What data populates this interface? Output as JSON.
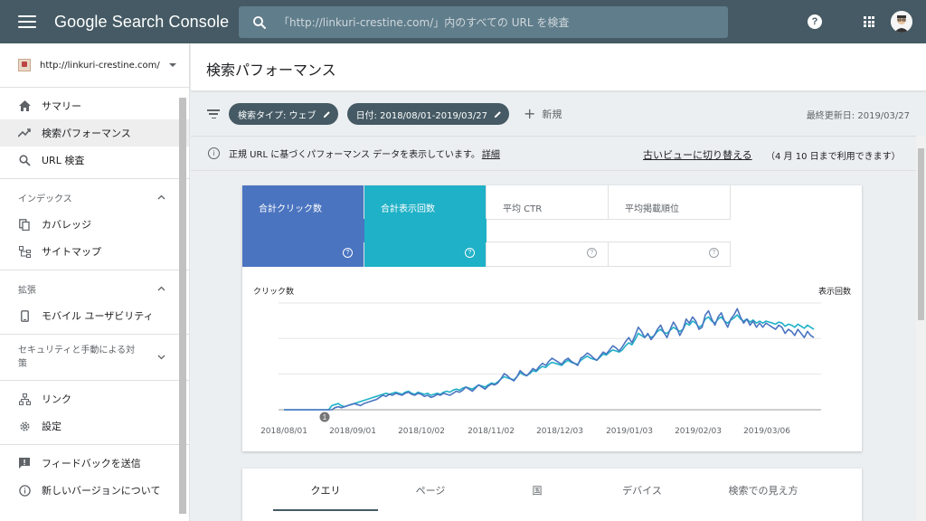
{
  "app": {
    "title": "Google Search Console",
    "search_placeholder": "「http://linkuri-crestine.com/」内のすべての URL を検査"
  },
  "sidebar": {
    "property": "http://linkuri-crestine.com/",
    "items_top": [
      {
        "label": "サマリー",
        "icon": "home-icon"
      },
      {
        "label": "検索パフォーマンス",
        "icon": "trending-icon",
        "active": true
      },
      {
        "label": "URL 検査",
        "icon": "search-icon"
      }
    ],
    "section_index": "インデックス",
    "items_index": [
      {
        "label": "カバレッジ",
        "icon": "copy-icon"
      },
      {
        "label": "サイトマップ",
        "icon": "sitemap-icon"
      }
    ],
    "section_ext": "拡張",
    "items_ext": [
      {
        "label": "モバイル ユーザビリティ",
        "icon": "phone-icon"
      }
    ],
    "section_security": "セキュリティと手動による対策",
    "items_bottom": [
      {
        "label": "リンク",
        "icon": "links-icon"
      },
      {
        "label": "設定",
        "icon": "gear-icon"
      }
    ],
    "items_footer": [
      {
        "label": "フィードバックを送信",
        "icon": "feedback-icon"
      },
      {
        "label": "新しいバージョンについて",
        "icon": "info-icon"
      }
    ]
  },
  "header": {
    "title": "検索パフォーマンス"
  },
  "filters": {
    "search_type": "検索タイプ: ウェブ",
    "date": "日付: 2018/08/01-2019/03/27",
    "new": "新規",
    "updated": "最終更新日: 2019/03/27"
  },
  "notice": {
    "text": "正規 URL に基づくパフォーマンス データを表示しています。",
    "detail": "詳細",
    "old_view": "古いビューに切り替える",
    "old_view_note": "（4 月 10 日まで利用できます）"
  },
  "metrics": [
    {
      "label": "合計クリック数",
      "selected": true,
      "color": "#4b74c0"
    },
    {
      "label": "合計表示回数",
      "selected": true,
      "color": "#1fb1c7"
    },
    {
      "label": "平均 CTR",
      "selected": false
    },
    {
      "label": "平均掲載順位",
      "selected": false
    }
  ],
  "chart_data": {
    "type": "line",
    "left_axis_label": "クリック数",
    "right_axis_label": "表示回数",
    "x_ticks": [
      "2018/08/01",
      "2018/09/01",
      "2018/10/02",
      "2018/11/02",
      "2018/12/03",
      "2019/01/03",
      "2019/02/03",
      "2019/03/06"
    ],
    "annotation": "1",
    "series": [
      {
        "color": "#4b74c0",
        "values": [
          0,
          0,
          0,
          0,
          0,
          0,
          0,
          0,
          0,
          0,
          0,
          0,
          0,
          0,
          0,
          0,
          0.02,
          0.03,
          0.02,
          0.03,
          0.04,
          0.05,
          0.06,
          0.05,
          0.04,
          0.06,
          0.07,
          0.08,
          0.09,
          0.1,
          0.12,
          0.14,
          0.13,
          0.15,
          0.14,
          0.16,
          0.15,
          0.14,
          0.16,
          0.17,
          0.15,
          0.14,
          0.16,
          0.15,
          0.13,
          0.14,
          0.12,
          0.13,
          0.15,
          0.14,
          0.16,
          0.15,
          0.14,
          0.16,
          0.18,
          0.17,
          0.19,
          0.22,
          0.2,
          0.18,
          0.21,
          0.24,
          0.22,
          0.2,
          0.23,
          0.25,
          0.24,
          0.26,
          0.3,
          0.35,
          0.33,
          0.3,
          0.28,
          0.32,
          0.38,
          0.35,
          0.33,
          0.36,
          0.4,
          0.38,
          0.42,
          0.45,
          0.43,
          0.47,
          0.5,
          0.48,
          0.46,
          0.44,
          0.48,
          0.5,
          0.47,
          0.45,
          0.43,
          0.5,
          0.52,
          0.55,
          0.53,
          0.5,
          0.48,
          0.52,
          0.56,
          0.54,
          0.58,
          0.62,
          0.6,
          0.57,
          0.61,
          0.66,
          0.7,
          0.65,
          0.72,
          0.8,
          0.76,
          0.7,
          0.74,
          0.68,
          0.72,
          0.78,
          0.82,
          0.75,
          0.7,
          0.78,
          0.85,
          0.8,
          0.72,
          0.78,
          0.88,
          0.84,
          0.9,
          0.86,
          0.78,
          0.8,
          0.92,
          0.96,
          0.88,
          0.82,
          0.9,
          0.94,
          0.86,
          0.8,
          0.88,
          0.92,
          0.98,
          0.9,
          0.84,
          0.88,
          0.82,
          0.86,
          0.8,
          0.84,
          0.8,
          0.84,
          0.82,
          0.8,
          0.78,
          0.82,
          0.8,
          0.74,
          0.78,
          0.76,
          0.72,
          0.78,
          0.74,
          0.7,
          0.76,
          0.72,
          0.7
        ]
      },
      {
        "color": "#1fb1c7",
        "values": [
          0,
          0,
          0,
          0,
          0,
          0,
          0,
          0,
          0,
          0,
          0,
          0,
          0,
          0,
          0,
          0.04,
          0.05,
          0.06,
          0.04,
          0.03,
          0.04,
          0.05,
          0.06,
          0.07,
          0.08,
          0.09,
          0.1,
          0.11,
          0.12,
          0.13,
          0.14,
          0.15,
          0.16,
          0.15,
          0.16,
          0.17,
          0.16,
          0.15,
          0.17,
          0.18,
          0.16,
          0.15,
          0.17,
          0.16,
          0.15,
          0.16,
          0.14,
          0.15,
          0.16,
          0.15,
          0.17,
          0.18,
          0.17,
          0.19,
          0.2,
          0.19,
          0.21,
          0.22,
          0.21,
          0.2,
          0.22,
          0.24,
          0.23,
          0.22,
          0.24,
          0.26,
          0.25,
          0.27,
          0.3,
          0.32,
          0.31,
          0.3,
          0.29,
          0.32,
          0.36,
          0.34,
          0.33,
          0.35,
          0.38,
          0.37,
          0.4,
          0.42,
          0.41,
          0.44,
          0.46,
          0.45,
          0.44,
          0.43,
          0.46,
          0.48,
          0.46,
          0.45,
          0.44,
          0.48,
          0.5,
          0.52,
          0.5,
          0.49,
          0.48,
          0.51,
          0.54,
          0.53,
          0.56,
          0.58,
          0.57,
          0.56,
          0.58,
          0.62,
          0.65,
          0.63,
          0.68,
          0.74,
          0.72,
          0.7,
          0.73,
          0.7,
          0.72,
          0.76,
          0.78,
          0.75,
          0.74,
          0.77,
          0.8,
          0.78,
          0.76,
          0.78,
          0.84,
          0.82,
          0.86,
          0.84,
          0.8,
          0.82,
          0.88,
          0.9,
          0.86,
          0.84,
          0.88,
          0.9,
          0.86,
          0.84,
          0.87,
          0.89,
          0.92,
          0.88,
          0.86,
          0.88,
          0.85,
          0.87,
          0.84,
          0.86,
          0.84,
          0.86,
          0.85,
          0.84,
          0.83,
          0.85,
          0.84,
          0.81,
          0.83,
          0.82,
          0.8,
          0.83,
          0.81,
          0.79,
          0.82,
          0.8,
          0.78
        ]
      }
    ]
  },
  "tabs": [
    "クエリ",
    "ページ",
    "国",
    "デバイス",
    "検索での見え方"
  ],
  "active_tab": "クエリ"
}
